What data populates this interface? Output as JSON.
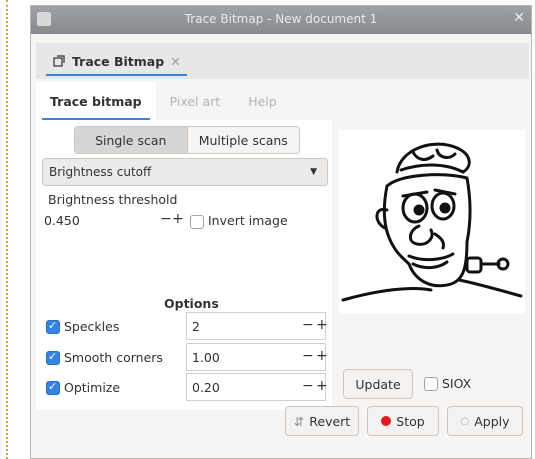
{
  "window": {
    "title": "Trace Bitmap - New document 1",
    "close_glyph": "✕"
  },
  "dock_tab": {
    "label": "Trace Bitmap",
    "icon": "trace-bitmap-icon",
    "close_glyph": "✕"
  },
  "subtabs": [
    {
      "label": "Trace bitmap",
      "active": true
    },
    {
      "label": "Pixel art",
      "active": false
    },
    {
      "label": "Help",
      "active": false
    }
  ],
  "scan_mode": {
    "single": "Single scan",
    "multiple": "Multiple scans",
    "selected": "Single scan"
  },
  "method_select": {
    "value": "Brightness cutoff",
    "arrow": "▼"
  },
  "threshold": {
    "label": "Brightness threshold",
    "value": "0.450",
    "minus": "−",
    "plus": "+",
    "invert_label": "Invert image",
    "invert_checked": false
  },
  "options": {
    "heading": "Options",
    "rows": [
      {
        "label": "Speckles",
        "value": "2",
        "checked": true
      },
      {
        "label": "Smooth corners",
        "value": "1.00",
        "checked": true
      },
      {
        "label": "Optimize",
        "value": "0.20",
        "checked": true
      }
    ],
    "minus": "−",
    "plus": "+"
  },
  "preview": {
    "update_label": "Update",
    "siox_label": "SIOX",
    "siox_checked": false
  },
  "actions": {
    "revert": "Revert",
    "revert_icon": "⇵",
    "stop": "Stop",
    "apply": "Apply",
    "apply_icon": "○"
  }
}
